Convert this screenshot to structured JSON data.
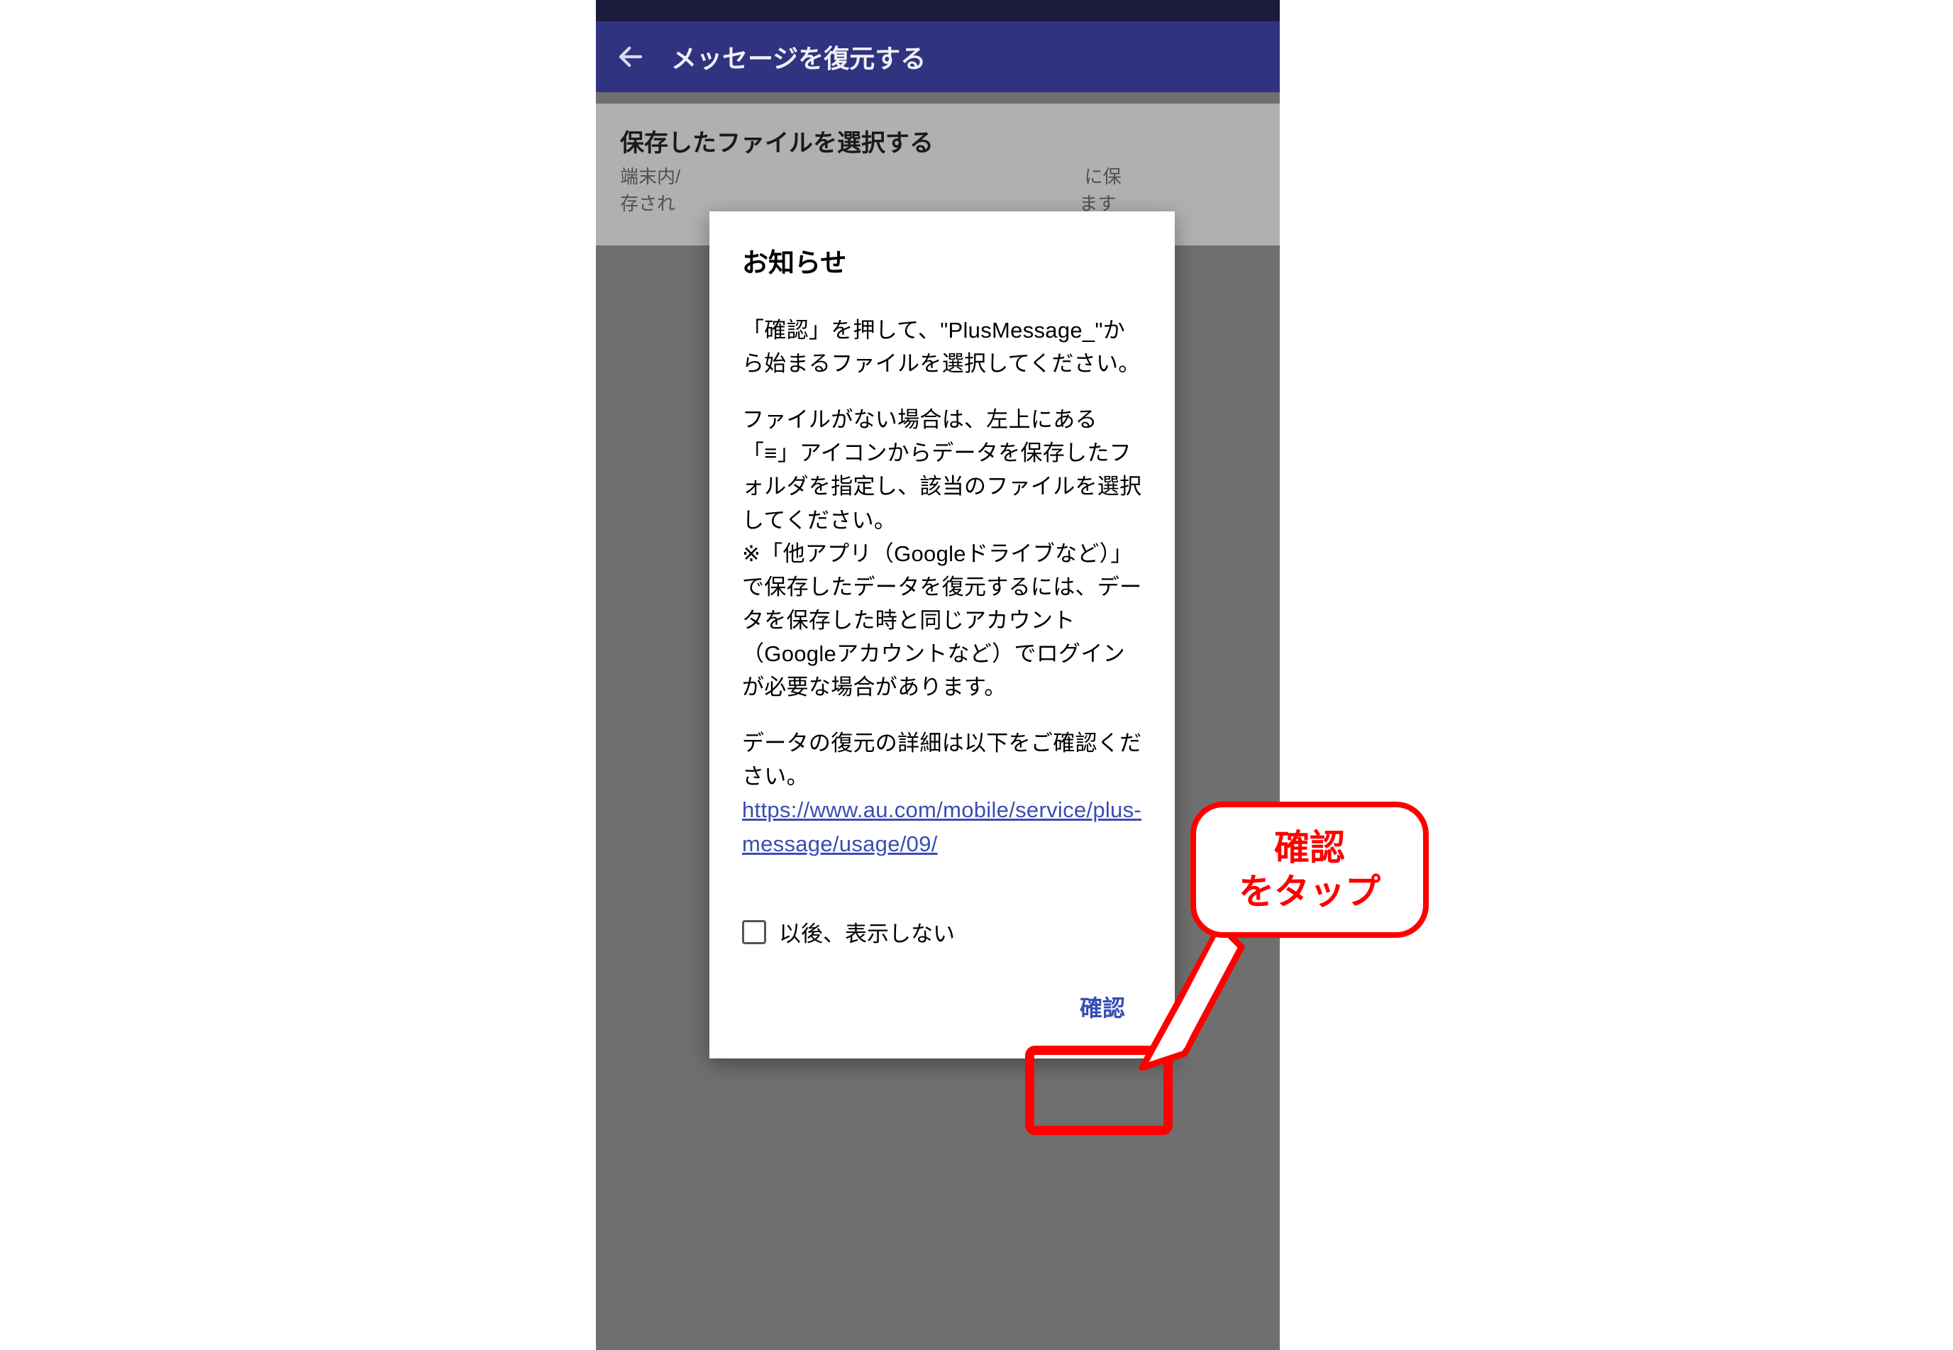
{
  "header": {
    "title": "メッセージを復元する"
  },
  "background_card": {
    "title": "保存したファイルを選択する",
    "subtitle_visible_prefix": "端末内/",
    "subtitle_visible_suffix_top": "に保",
    "subtitle_visible_prefix2": "存され",
    "subtitle_visible_suffix_bot": "ます"
  },
  "dialog": {
    "title": "お知らせ",
    "para1": "「確認」を押して、\"PlusMessage_\"から始まるファイルを選択してください。",
    "para2": "ファイルがない場合は、左上にある「≡」アイコンからデータを保存したフォルダを指定し、該当のファイルを選択してください。\n※「他アプリ（Googleドライブなど）」で保存したデータを復元するには、データを保存した時と同じアカウント（Googleアカウントなど）でログインが必要な場合があります。",
    "para3": "データの復元の詳細は以下をご確認ください。",
    "link_text": "https://www.au.com/mobile/service/plus-message/usage/09/",
    "checkbox_label": "以後、表示しない",
    "confirm_label": "確認"
  },
  "callout": {
    "line1": "確認",
    "line2": "をタップ"
  }
}
